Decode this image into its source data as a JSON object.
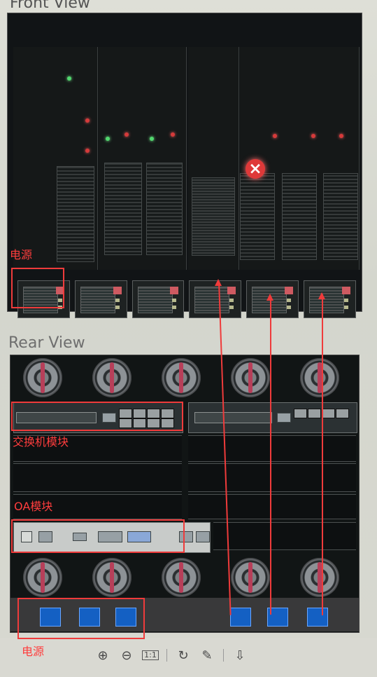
{
  "front_view": {
    "title": "Front View"
  },
  "rear_view": {
    "title": "Rear View"
  },
  "annotations": {
    "power_top": "电源",
    "switch_module": "交换机模块",
    "oa_module": "OA模块",
    "power_bottom": "电源"
  },
  "toolbar": {
    "zoom_in_icon": "zoom-in-icon",
    "zoom_out_icon": "zoom-out-icon",
    "actual_size": "1:1",
    "rotate_icon": "rotate-icon",
    "edit_icon": "pencil-icon",
    "download_icon": "download-icon"
  },
  "colors": {
    "annotation": "#ef3b3b",
    "psu_blue": "#1460c3",
    "fault_red": "#df3939"
  }
}
